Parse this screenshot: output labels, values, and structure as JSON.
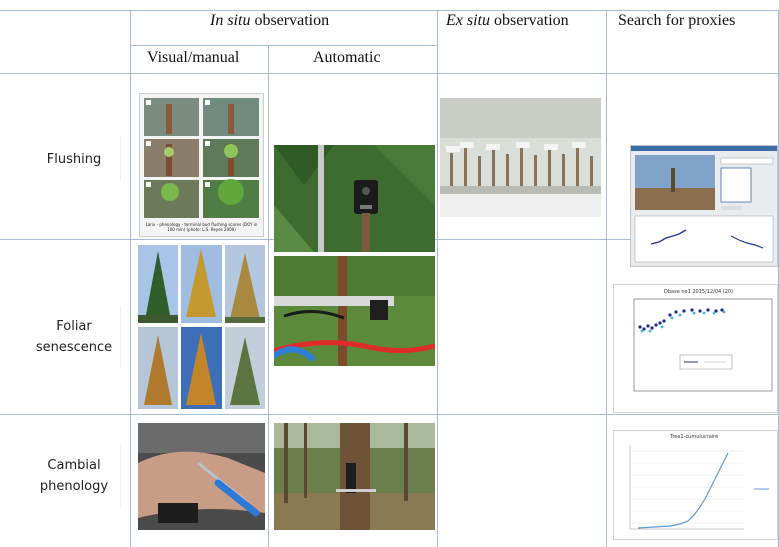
{
  "table": {
    "header_in_situ_italic": "In situ",
    "header_in_situ_rest": " observation",
    "header_ex_situ_italic": "Ex situ",
    "header_ex_situ_rest": " observation",
    "header_proxies": "Search for proxies",
    "sub_visual": "Visual/manual",
    "sub_automatic": "Automatic",
    "rows": [
      {
        "line1": "Flushing",
        "line2": ""
      },
      {
        "line1": "Foliar",
        "line2": "senescence"
      },
      {
        "line1": "Cambial",
        "line2": "phenology"
      }
    ]
  },
  "images": {
    "flushing_panel_caption": "Larix - phenology - terminal bud flushing scores (DOY in 100 min) (photo: L.S. Reyes 2009)",
    "senescence_plot_title": "Dbase no1 2015/12/04 (20)",
    "cambial_plot_title": "Tree1-cumulucraire"
  }
}
